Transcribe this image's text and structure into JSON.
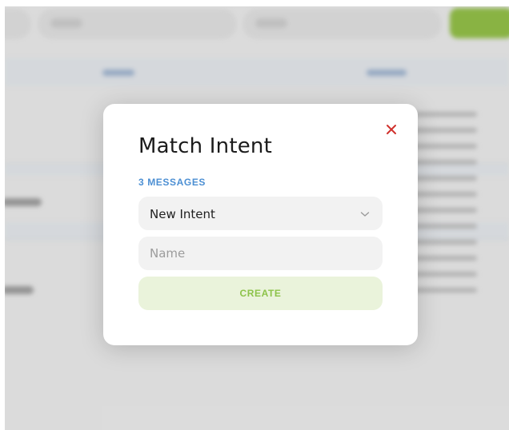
{
  "modal": {
    "title": "Match Intent",
    "message_count": "3 MESSAGES",
    "intent_select": {
      "value": "New Intent",
      "icon": "chevron-down-icon"
    },
    "name_field": {
      "value": "",
      "placeholder": "Name"
    },
    "create_label": "CREATE",
    "close_icon": "close-icon"
  },
  "colors": {
    "title": "#1b1b1b",
    "accent_blue": "#4c8fd3",
    "close_red": "#d0312d",
    "create_text": "#8dc34a",
    "create_bg": "#eaf3db",
    "field_bg": "#f2f2f2",
    "brand_green": "#8dbf3a"
  }
}
